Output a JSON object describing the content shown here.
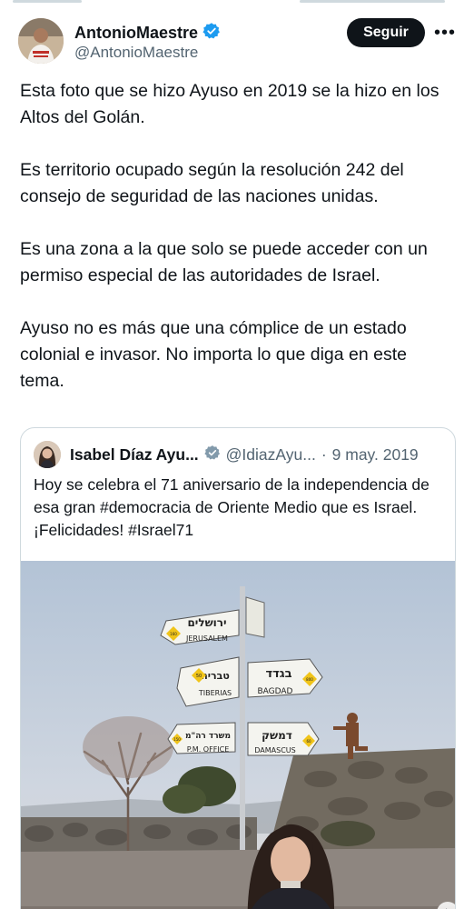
{
  "author": {
    "name": "AntonioMaestre",
    "handle": "@AntonioMaestre",
    "verified_icon": "verified-badge-icon",
    "accent": "#1d9bf0"
  },
  "actions": {
    "follow_label": "Seguir",
    "more_label": "•••"
  },
  "tweet": {
    "paragraphs": [
      "Esta foto que se hizo Ayuso en 2019 se la hizo en los Altos del Golán.",
      "Es territorio ocupado según la resolución 242 del consejo de seguridad de las naciones unidas.",
      "Es una zona a la que solo se puede acceder con un permiso especial de las autoridades de Israel.",
      "Ayuso no es más que una cómplice de un estado colonial e invasor. No importa lo que diga en este tema."
    ]
  },
  "quote": {
    "name": "Isabel Díaz Ayu...",
    "handle": "@IdiazAyu...",
    "separator": "·",
    "date": "9 may. 2019",
    "text": "Hoy se celebra el 71 aniversario de  la independencia de esa gran #democracia de Oriente Medio que es Israel. ¡Felicidades! #Israel71",
    "signs": {
      "jerusalem_he": "ירושלים",
      "jerusalem_en": "JERUSALEM",
      "tiberias_he": "טבריה",
      "tiberias_en": "TIBERIAS",
      "tiberias_km": "50",
      "bagdad_he": "בגדד",
      "bagdad_en": "BAGDAD",
      "bagdad_km": "800",
      "pm_office_he": "משרד רה\"מ",
      "pm_office_en": "P.M. OFFICE",
      "damascus_he": "דמשק",
      "damascus_en": "DAMASCUS",
      "damascus_km": "60",
      "jerusalem_km": "160",
      "pm_km": "150"
    }
  }
}
